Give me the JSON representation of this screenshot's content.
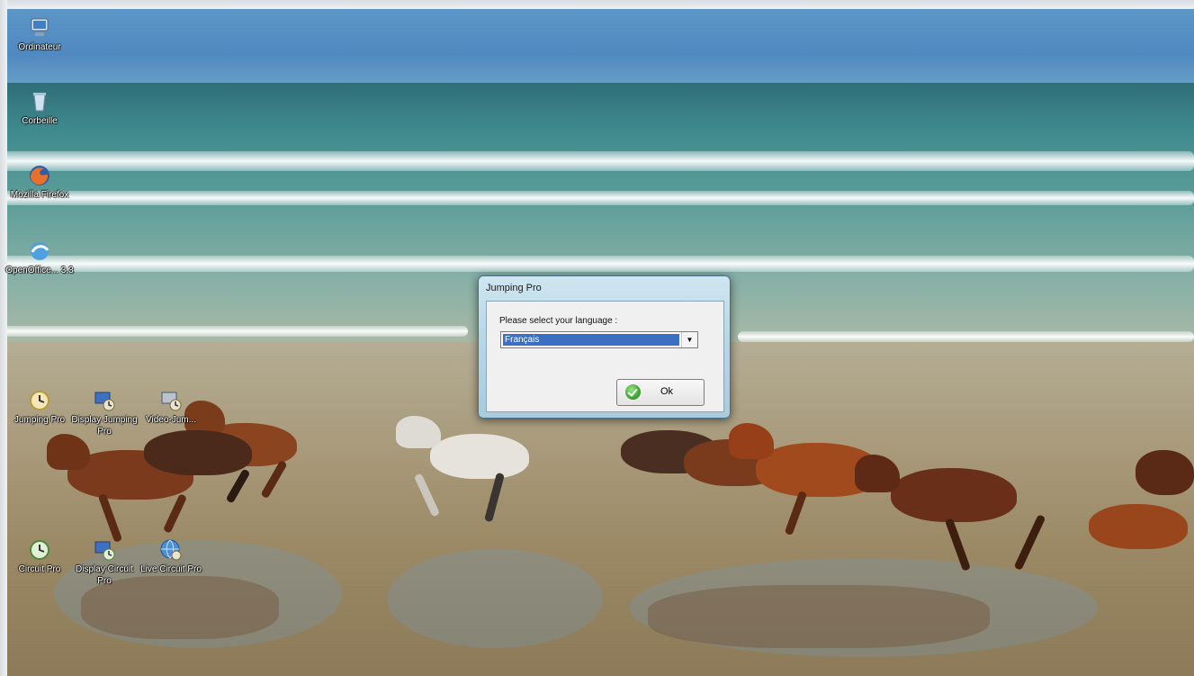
{
  "desktop": {
    "icons": [
      {
        "label": "Ordinateur",
        "icon": "computer-icon"
      },
      {
        "label": "Corbeille",
        "icon": "recycle-bin-icon"
      },
      {
        "label": "Mozilla Firefox",
        "icon": "firefox-icon"
      },
      {
        "label": "OpenOffice... 3.3",
        "icon": "openoffice-icon"
      },
      {
        "label": "Jumping Pro",
        "icon": "clock-app-icon"
      },
      {
        "label": "Display Jumping Pro",
        "icon": "display-app-icon"
      },
      {
        "label": "Video-Jum...",
        "icon": "video-app-icon"
      },
      {
        "label": "Circuit Pro",
        "icon": "clock-app-icon"
      },
      {
        "label": "Display Circuit Pro",
        "icon": "display-app-icon"
      },
      {
        "label": "Live Circuit Pro",
        "icon": "globe-app-icon"
      }
    ]
  },
  "dialog": {
    "title": "Jumping Pro",
    "prompt": "Please select your language :",
    "language_selected": "Français",
    "ok_label": "Ok"
  },
  "colors": {
    "dialog_frame": "#b9d8e6",
    "selection": "#3a6fc4",
    "ok_check": "#3ea533"
  }
}
